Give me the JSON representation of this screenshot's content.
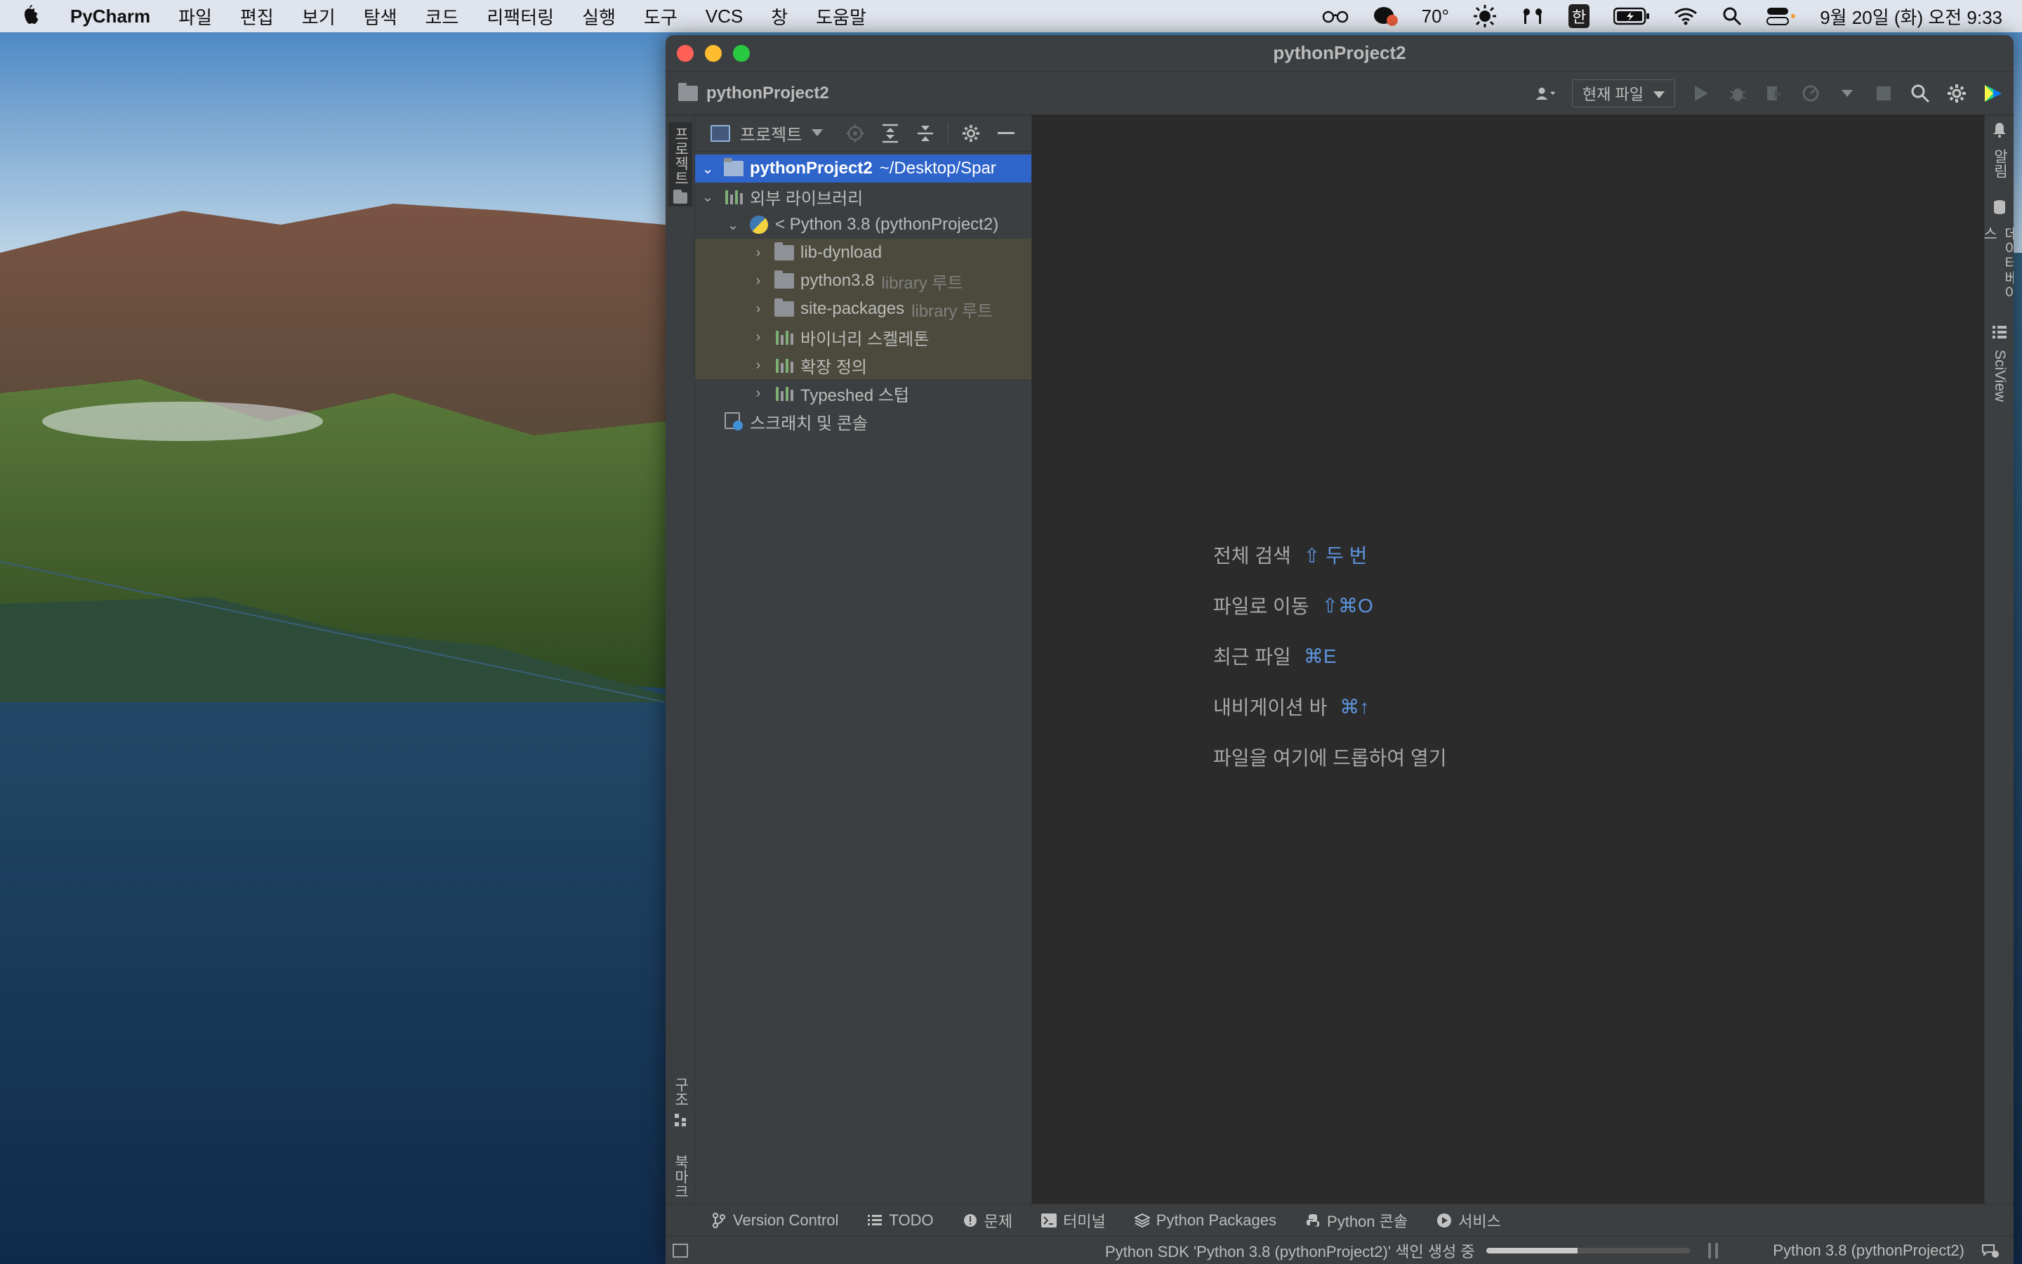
{
  "menubar": {
    "app_name": "PyCharm",
    "items": [
      "파일",
      "편집",
      "보기",
      "탐색",
      "코드",
      "리팩터링",
      "실행",
      "도구",
      "VCS",
      "창",
      "도움말"
    ],
    "weather": "70°",
    "ime": "한",
    "clock": "9월 20일 (화) 오전 9:33"
  },
  "window": {
    "title": "pythonProject2",
    "breadcrumb": "pythonProject2",
    "run_config": "현재 파일"
  },
  "left_stripe": {
    "project_tab": "프로젝트",
    "structure_tab": "구조",
    "bookmarks_tab": "북마크"
  },
  "right_stripe": {
    "notifications_tab": "알림",
    "database_tab": "데이터베이스",
    "sciview_tab": "SciView"
  },
  "project_panel": {
    "view_label": "프로젝트",
    "tree": [
      {
        "label": "pythonProject2",
        "hint": "~/Desktop/Spar",
        "selected": true,
        "depth": 0,
        "expanded": true,
        "icon": "folder-icon"
      },
      {
        "label": "외부 라이브러리",
        "hint": "",
        "depth": 0,
        "expanded": true,
        "icon": "libraries-icon"
      },
      {
        "label": "< Python 3.8 (pythonProject2)",
        "hint": "",
        "depth": 1,
        "expanded": true,
        "icon": "python-icon"
      },
      {
        "label": "lib-dynload",
        "hint": "",
        "depth": 2,
        "expanded": false,
        "icon": "folder-icon"
      },
      {
        "label": "python3.8",
        "hint": "library 루트",
        "depth": 2,
        "expanded": false,
        "icon": "folder-icon"
      },
      {
        "label": "site-packages",
        "hint": "library 루트",
        "depth": 2,
        "expanded": false,
        "icon": "folder-icon"
      },
      {
        "label": "바이너리 스켈레톤",
        "hint": "",
        "depth": 2,
        "expanded": false,
        "icon": "libraries-icon"
      },
      {
        "label": "확장 정의",
        "hint": "",
        "depth": 2,
        "expanded": false,
        "icon": "libraries-icon"
      },
      {
        "label": "Typeshed 스텁",
        "hint": "",
        "depth": 2,
        "expanded": false,
        "icon": "libraries-icon"
      },
      {
        "label": "스크래치 및 콘솔",
        "hint": "",
        "depth": 0,
        "expanded": null,
        "icon": "scratches-icon"
      }
    ]
  },
  "editor_hints": [
    {
      "label": "전체 검색",
      "shortcut": "⇧ 두 번"
    },
    {
      "label": "파일로 이동",
      "shortcut": "⇧⌘O"
    },
    {
      "label": "최근 파일",
      "shortcut": "⌘E"
    },
    {
      "label": "내비게이션 바",
      "shortcut": "⌘↑"
    },
    {
      "label": "파일을 여기에 드롭하여 열기",
      "shortcut": ""
    }
  ],
  "bottom_tabs": [
    "Version Control",
    "TODO",
    "문제",
    "터미널",
    "Python Packages",
    "Python 콘솔",
    "서비스"
  ],
  "status": {
    "task": "Python SDK 'Python 3.8 (pythonProject2)' 색인 생성 중",
    "progress": 0.45,
    "interpreter": "Python 3.8 (pythonProject2)"
  },
  "colors": {
    "selection": "#2f65ca",
    "shortcut": "#5d95df",
    "library_row": "#4b4a3c"
  }
}
